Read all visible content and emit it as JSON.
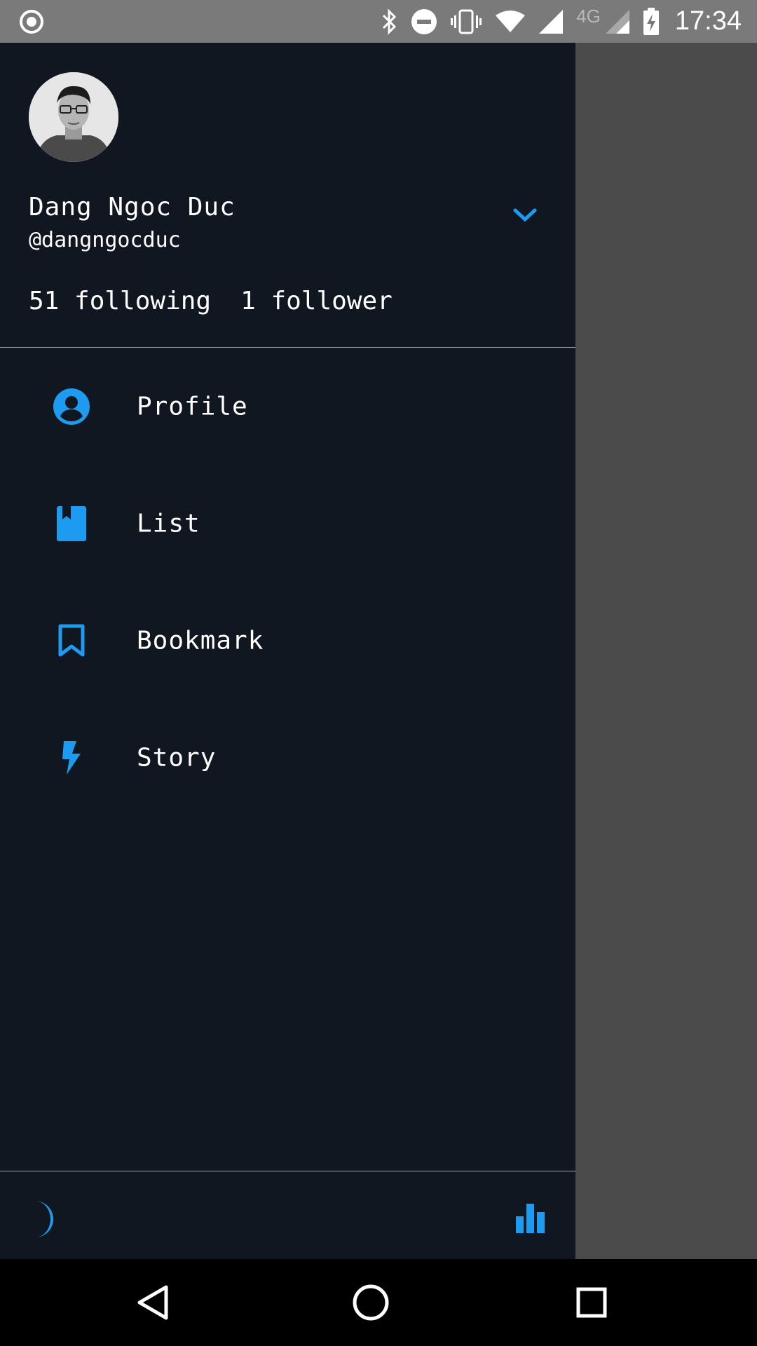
{
  "status_bar": {
    "time": "17:34",
    "network_label": "4G"
  },
  "profile": {
    "display_name": "Dang Ngoc Duc",
    "username": "@dangngocduc",
    "following": "51 following",
    "followers": "1 follower"
  },
  "menu": {
    "items": [
      {
        "label": "Profile",
        "icon": "person-circle-icon"
      },
      {
        "label": "List",
        "icon": "list-book-icon"
      },
      {
        "label": "Bookmark",
        "icon": "bookmark-icon"
      },
      {
        "label": "Story",
        "icon": "lightning-icon"
      }
    ]
  },
  "footer": {
    "left_icon": "moon-icon",
    "right_icon": "bar-chart-icon"
  },
  "colors": {
    "accent": "#1d9bf0",
    "drawer_bg": "#111721",
    "scrim": "#4b4b4b",
    "status_bar": "#7a7a7a"
  }
}
